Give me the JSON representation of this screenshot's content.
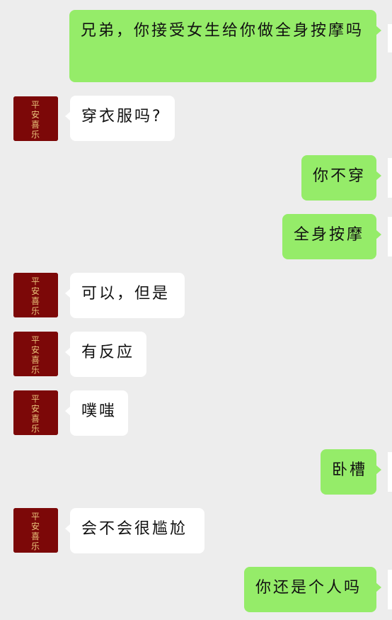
{
  "conversation": {
    "messages": [
      {
        "sender": "me",
        "text": "兄弟，你接受女生给你做全身按摩吗"
      },
      {
        "sender": "other",
        "text": "穿衣服吗?"
      },
      {
        "sender": "me",
        "text": "你不穿"
      },
      {
        "sender": "me",
        "text": "全身按摩"
      },
      {
        "sender": "other",
        "text": "可以，但是"
      },
      {
        "sender": "other",
        "text": "有反应"
      },
      {
        "sender": "other",
        "text": "噗嗤"
      },
      {
        "sender": "me",
        "text": "卧槽"
      },
      {
        "sender": "other",
        "text": "会不会很尴尬"
      },
      {
        "sender": "me",
        "text": "你还是个人吗"
      }
    ]
  },
  "avatar": {
    "icon": "red-calligraphy-seal-icon",
    "text": "平安喜乐"
  },
  "colors": {
    "background": "#ededed",
    "sent_bubble": "#95ec69",
    "received_bubble": "#ffffff",
    "avatar": "#7c0808"
  }
}
